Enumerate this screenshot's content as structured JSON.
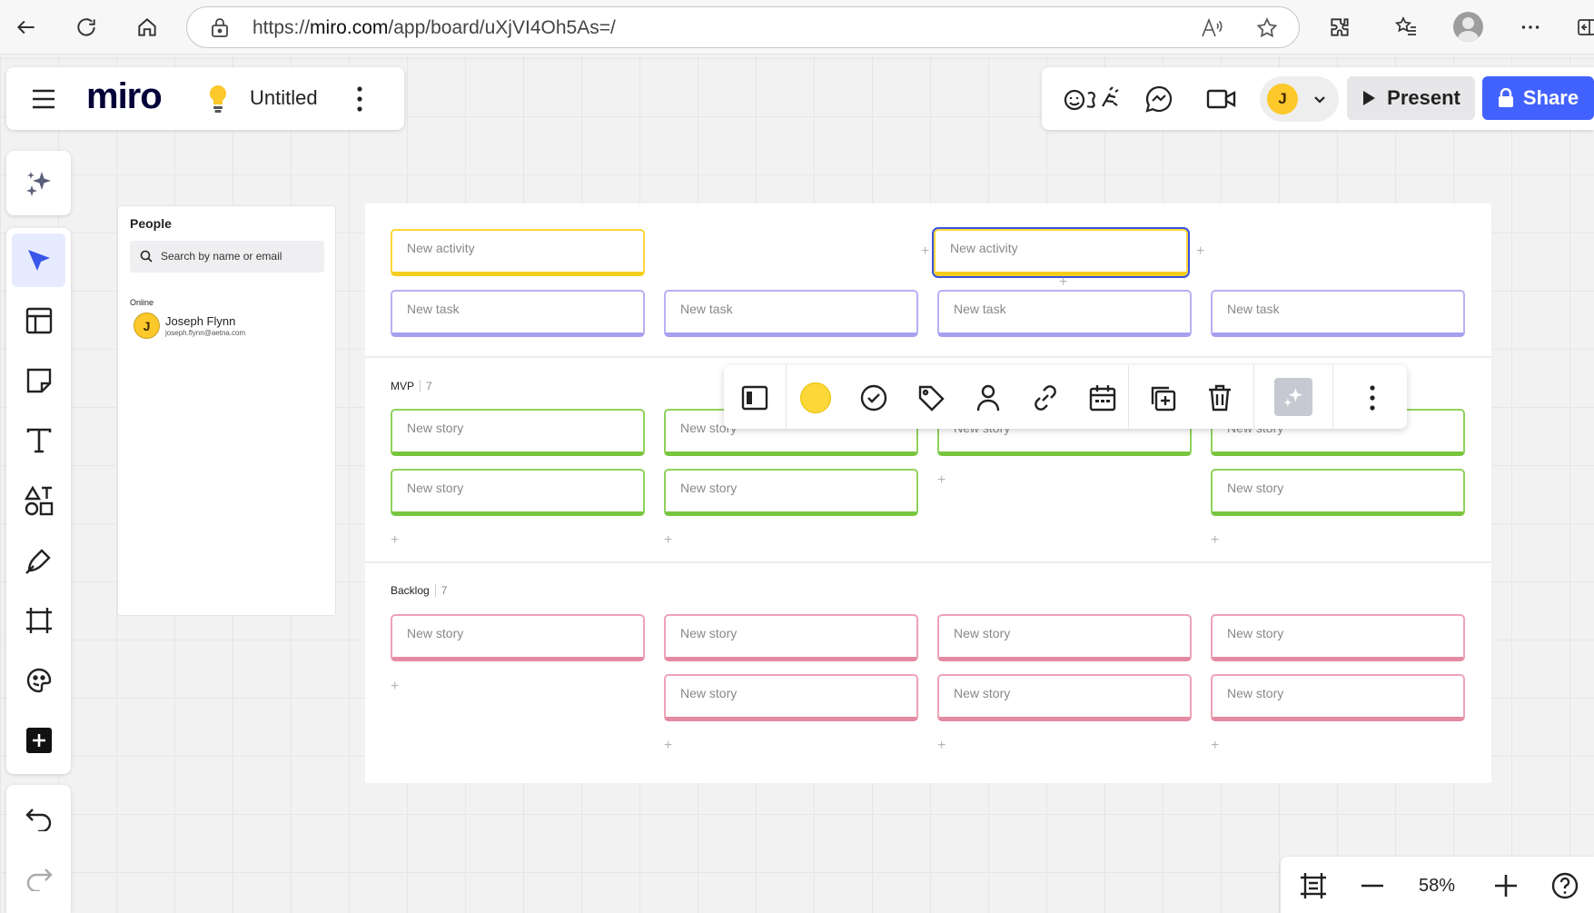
{
  "browser": {
    "url_prefix": "https://",
    "url_host": "miro.com",
    "url_path": "/app/board/uXjVI4Oh5As=/"
  },
  "app": {
    "logo": "miro",
    "board_title": "Untitled"
  },
  "header": {
    "collaborator_initial": "J",
    "present_label": "Present",
    "share_label": "Share"
  },
  "people_panel": {
    "title": "People",
    "search_placeholder": "Search by name or email",
    "online_label": "Online",
    "person": {
      "initial": "J",
      "name": "Joseph Flynn",
      "email": "joseph.flynn@aetna.com"
    }
  },
  "board": {
    "activities": [
      "New activity",
      "New activity"
    ],
    "tasks": [
      "New task",
      "New task",
      "New task",
      "New task"
    ],
    "mvp": {
      "label": "MVP",
      "count": "7",
      "stories": [
        "New story",
        "New story",
        "New story",
        "New story",
        "New story",
        "New story",
        "New story"
      ]
    },
    "backlog": {
      "label": "Backlog",
      "count": "7",
      "stories": [
        "New story",
        "New story",
        "New story",
        "New story",
        "New story",
        "New story",
        "New story"
      ]
    },
    "add_symbol": "+"
  },
  "context_toolbar": {
    "color": "#fcd73a"
  },
  "zoom": {
    "level": "58%"
  },
  "colors": {
    "accent": "#4262ff",
    "activity": "#fcd63a",
    "task": "#b8b1f2",
    "mvp": "#8fd25b",
    "backlog": "#eea2b7"
  }
}
